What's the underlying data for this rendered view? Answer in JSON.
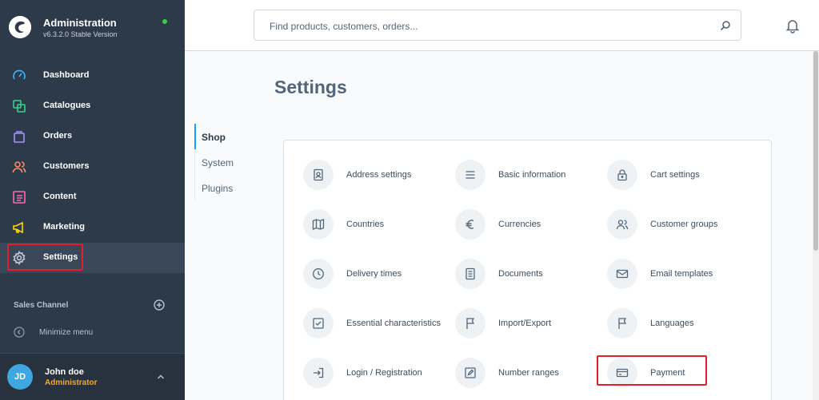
{
  "app": {
    "title": "Administration",
    "version": "v6.3.2.0 Stable Version",
    "status_color": "#37d046"
  },
  "sidebar": {
    "items": [
      {
        "label": "Dashboard",
        "icon": "dashboard-icon"
      },
      {
        "label": "Catalogues",
        "icon": "catalogues-icon"
      },
      {
        "label": "Orders",
        "icon": "orders-icon"
      },
      {
        "label": "Customers",
        "icon": "customers-icon"
      },
      {
        "label": "Content",
        "icon": "content-icon"
      },
      {
        "label": "Marketing",
        "icon": "marketing-icon"
      },
      {
        "label": "Settings",
        "icon": "gear-icon",
        "active": true
      }
    ],
    "sales_channel_label": "Sales Channel",
    "minimize_label": "Minimize menu"
  },
  "user": {
    "initials": "JD",
    "name": "John doe",
    "role": "Administrator"
  },
  "search": {
    "placeholder": "Find products, customers, orders..."
  },
  "page": {
    "title": "Settings",
    "tabs": [
      {
        "label": "Shop",
        "active": true
      },
      {
        "label": "System"
      },
      {
        "label": "Plugins"
      }
    ]
  },
  "settings": {
    "rows": [
      [
        {
          "label": "Address settings",
          "icon": "address-icon"
        },
        {
          "label": "Basic information",
          "icon": "list-icon"
        },
        {
          "label": "Cart settings",
          "icon": "lock-icon"
        }
      ],
      [
        {
          "label": "Countries",
          "icon": "map-icon"
        },
        {
          "label": "Currencies",
          "icon": "euro-icon"
        },
        {
          "label": "Customer groups",
          "icon": "users-icon"
        }
      ],
      [
        {
          "label": "Delivery times",
          "icon": "clock-icon"
        },
        {
          "label": "Documents",
          "icon": "document-icon"
        },
        {
          "label": "Email templates",
          "icon": "mail-icon"
        }
      ],
      [
        {
          "label": "Essential characteristics",
          "icon": "checkbox-icon"
        },
        {
          "label": "Import/Export",
          "icon": "flag-icon"
        },
        {
          "label": "Languages",
          "icon": "flag-icon"
        }
      ],
      [
        {
          "label": "Login / Registration",
          "icon": "login-icon"
        },
        {
          "label": "Number ranges",
          "icon": "pencil-icon"
        },
        {
          "label": "Payment",
          "icon": "credit-card-icon"
        }
      ]
    ]
  },
  "colors": {
    "sidebar_bg": "#2d3a4a",
    "accent": "#189eff",
    "highlight": "#e0202a",
    "role": "#f5a623"
  }
}
